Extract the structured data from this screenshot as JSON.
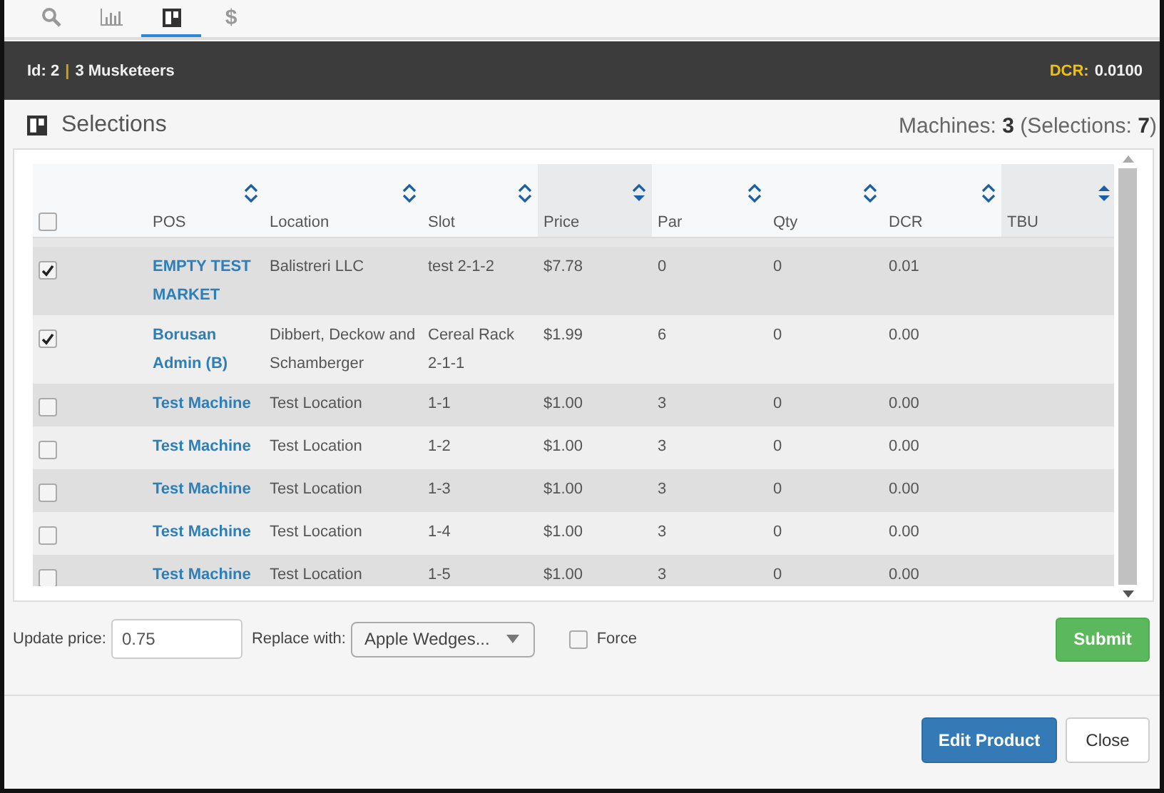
{
  "tabs": [
    {
      "kind": "search",
      "selected": false
    },
    {
      "kind": "chart",
      "selected": false
    },
    {
      "kind": "layout",
      "selected": true
    },
    {
      "kind": "text",
      "label": "$",
      "selected": false
    }
  ],
  "header_bar": {
    "id_label": "Id: 2",
    "separator": "|",
    "name": "3 Musketeers",
    "dcr_label": "DCR:",
    "dcr_value": "0.0100"
  },
  "section": {
    "title": "Selections",
    "machines_label": "Machines:",
    "machines": "3",
    "selections_label": "(Selections:",
    "selections": "7",
    "close_paren": ")"
  },
  "table": {
    "select_all": {
      "checked": false
    },
    "columns": [
      {
        "label": "POS",
        "up_filled": false,
        "down_filled": false,
        "highlighted": false
      },
      {
        "label": "Location",
        "up_filled": false,
        "down_filled": false,
        "highlighted": false
      },
      {
        "label": "Slot",
        "up_filled": false,
        "down_filled": false,
        "highlighted": false
      },
      {
        "label": "Price",
        "up_filled": false,
        "down_filled": true,
        "highlighted": true
      },
      {
        "label": "Par",
        "up_filled": false,
        "down_filled": false,
        "highlighted": false
      },
      {
        "label": "Qty",
        "up_filled": false,
        "down_filled": false,
        "highlighted": false
      },
      {
        "label": "DCR",
        "up_filled": false,
        "down_filled": false,
        "highlighted": false
      },
      {
        "label": "TBU",
        "up_filled": true,
        "down_filled": true,
        "highlighted": true
      }
    ],
    "rows": [
      {
        "checked": true,
        "pos": "EMPTY TEST MARKET",
        "location": "Balistreri LLC",
        "slot": "test 2-1-2",
        "price": "$7.78",
        "par": "0",
        "qty": "0",
        "dcr": "0.01"
      },
      {
        "checked": true,
        "pos": "Borusan Admin (B)",
        "location": "Dibbert, Deckow and Schamberger",
        "slot": "Cereal Rack 2-1-1",
        "price": "$1.99",
        "par": "6",
        "qty": "0",
        "dcr": "0.00"
      },
      {
        "checked": false,
        "pos": "Test Machine",
        "location": "Test Location",
        "slot": "1-1",
        "price": "$1.00",
        "par": "3",
        "qty": "0",
        "dcr": "0.00"
      },
      {
        "checked": false,
        "pos": "Test Machine",
        "location": "Test Location",
        "slot": "1-2",
        "price": "$1.00",
        "par": "3",
        "qty": "0",
        "dcr": "0.00"
      },
      {
        "checked": false,
        "pos": "Test Machine",
        "location": "Test Location",
        "slot": "1-3",
        "price": "$1.00",
        "par": "3",
        "qty": "0",
        "dcr": "0.00"
      },
      {
        "checked": false,
        "pos": "Test Machine",
        "location": "Test Location",
        "slot": "1-4",
        "price": "$1.00",
        "par": "3",
        "qty": "0",
        "dcr": "0.00"
      },
      {
        "checked": false,
        "pos": "Test Machine",
        "location": "Test Location",
        "slot": "1-5",
        "price": "$1.00",
        "par": "3",
        "qty": "0",
        "dcr": "0.00"
      }
    ]
  },
  "update_form": {
    "price_label": "Update price:",
    "price_value": "0.75",
    "replace_label": "Replace with:",
    "replace_value": "Apple Wedges...",
    "force_label": "Force",
    "force_checked": false,
    "submit": "Submit"
  },
  "footer": {
    "buttons": [
      {
        "label": "Edit Product",
        "kind": "primary"
      },
      {
        "label": "Close",
        "kind": "default"
      }
    ]
  }
}
